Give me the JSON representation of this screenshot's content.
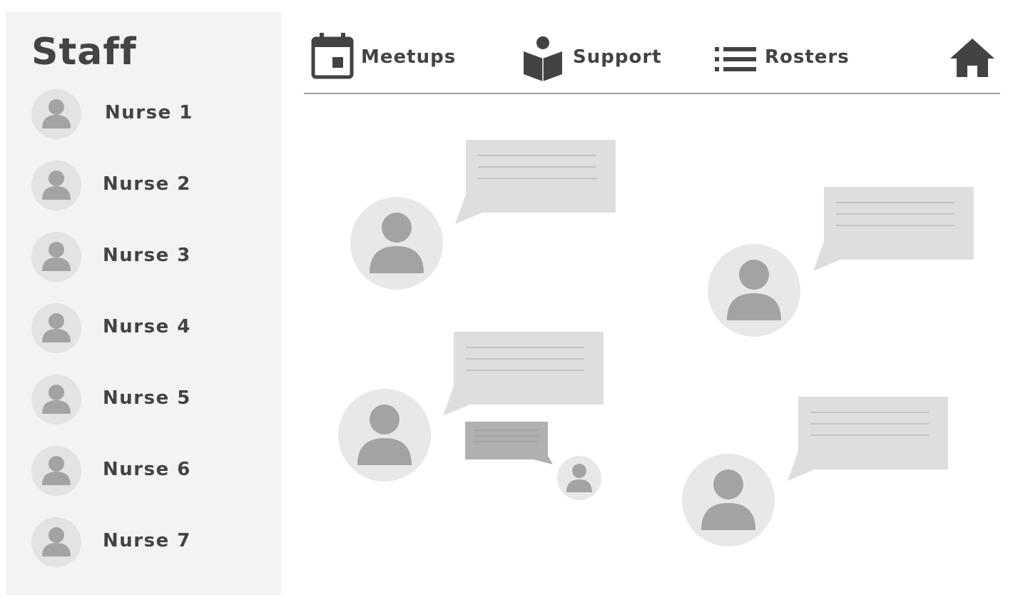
{
  "sidebar": {
    "title": "Staff",
    "items": [
      {
        "label": "Nurse 1"
      },
      {
        "label": "Nurse 2"
      },
      {
        "label": "Nurse 3"
      },
      {
        "label": "Nurse 4"
      },
      {
        "label": "Nurse 5"
      },
      {
        "label": "Nurse 6"
      },
      {
        "label": "Nurse 7"
      }
    ]
  },
  "nav": {
    "meetups": {
      "label": "Meetups",
      "icon": "calendar-icon"
    },
    "support": {
      "label": "Support",
      "icon": "reading-person-icon"
    },
    "rosters": {
      "label": "Rosters",
      "icon": "list-icon"
    },
    "home": {
      "icon": "home-icon"
    }
  },
  "colors": {
    "text": "#434343",
    "sidebar_bg": "#f2f3f5",
    "avatar_bg": "#e8e8e8",
    "avatar_fg": "#a3a3a3",
    "bubble": "#dedede",
    "bubble_dark": "#b0b0b0"
  }
}
